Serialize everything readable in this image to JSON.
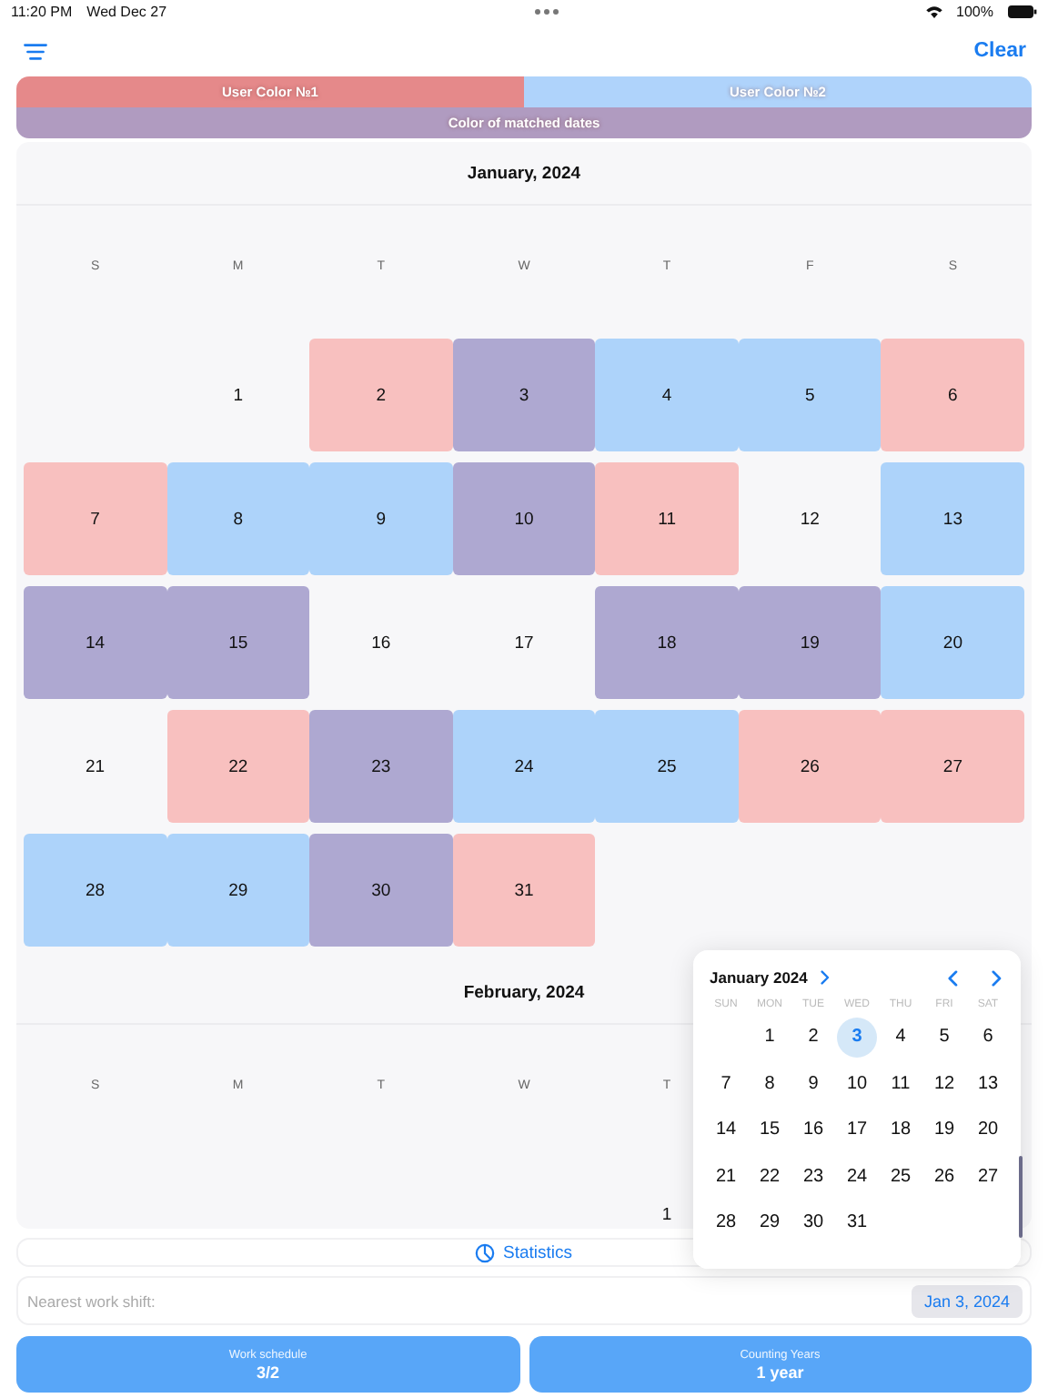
{
  "status_bar": {
    "time": "11:20 PM",
    "date": "Wed Dec 27",
    "battery": "100%"
  },
  "toolbar": {
    "clear": "Clear"
  },
  "legend": {
    "user_1": {
      "label": "User Color №1",
      "color": "#e5898a"
    },
    "user_2": {
      "label": "User Color №2",
      "color": "#afd3fb"
    },
    "matched": {
      "label": "Color of matched dates",
      "color": "#b09bc0"
    }
  },
  "months": [
    {
      "title": "January, 2024",
      "weekdays": [
        "S",
        "M",
        "T",
        "W",
        "T",
        "F",
        "S"
      ],
      "weeks": [
        [
          {
            "kind": "blank"
          },
          {
            "kind": "day",
            "label": "1"
          },
          {
            "kind": "day",
            "label": "2",
            "color": "#f8c0bf"
          },
          {
            "kind": "day",
            "label": "3",
            "color": "#aea8d1"
          },
          {
            "kind": "day",
            "label": "4",
            "color": "#add3fa"
          },
          {
            "kind": "day",
            "label": "5",
            "color": "#add3fa"
          },
          {
            "kind": "day",
            "label": "6",
            "color": "#f8c0bf"
          }
        ],
        [
          {
            "kind": "day",
            "label": "7",
            "color": "#f8c0bf"
          },
          {
            "kind": "day",
            "label": "8",
            "color": "#add3fa"
          },
          {
            "kind": "day",
            "label": "9",
            "color": "#add3fa"
          },
          {
            "kind": "day",
            "label": "10",
            "color": "#aea8d1"
          },
          {
            "kind": "day",
            "label": "11",
            "color": "#f8c0bf"
          },
          {
            "kind": "day",
            "label": "12"
          },
          {
            "kind": "day",
            "label": "13",
            "color": "#add3fa"
          }
        ],
        [
          {
            "kind": "day",
            "label": "14",
            "color": "#aea8d1"
          },
          {
            "kind": "day",
            "label": "15",
            "color": "#aea8d1"
          },
          {
            "kind": "day",
            "label": "16"
          },
          {
            "kind": "day",
            "label": "17"
          },
          {
            "kind": "day",
            "label": "18",
            "color": "#aea8d1"
          },
          {
            "kind": "day",
            "label": "19",
            "color": "#aea8d1"
          },
          {
            "kind": "day",
            "label": "20",
            "color": "#add3fa"
          }
        ],
        [
          {
            "kind": "day",
            "label": "21"
          },
          {
            "kind": "day",
            "label": "22",
            "color": "#f8c0bf"
          },
          {
            "kind": "day",
            "label": "23",
            "color": "#aea8d1"
          },
          {
            "kind": "day",
            "label": "24",
            "color": "#add3fa"
          },
          {
            "kind": "day",
            "label": "25",
            "color": "#add3fa"
          },
          {
            "kind": "day",
            "label": "26",
            "color": "#f8c0bf"
          },
          {
            "kind": "day",
            "label": "27",
            "color": "#f8c0bf"
          }
        ],
        [
          {
            "kind": "day",
            "label": "28",
            "color": "#add3fa"
          },
          {
            "kind": "day",
            "label": "29",
            "color": "#add3fa"
          },
          {
            "kind": "day",
            "label": "30",
            "color": "#aea8d1"
          },
          {
            "kind": "day",
            "label": "31",
            "color": "#f8c0bf"
          }
        ]
      ]
    },
    {
      "title": "February, 2024",
      "weekdays": [
        "S",
        "M",
        "T",
        "W",
        "T"
      ],
      "weeks": [
        [
          {
            "kind": "blank"
          },
          {
            "kind": "blank"
          },
          {
            "kind": "blank"
          },
          {
            "kind": "blank"
          },
          {
            "kind": "day",
            "label": "1"
          }
        ]
      ]
    }
  ],
  "date_picker": {
    "title": "January 2024",
    "weekdays": [
      "SUN",
      "MON",
      "TUE",
      "WED",
      "THU",
      "FRI",
      "SAT"
    ],
    "weeks": [
      [
        {
          "kind": "blank"
        },
        {
          "kind": "day",
          "label": "1",
          "selected": false
        },
        {
          "kind": "day",
          "label": "2",
          "selected": false
        },
        {
          "kind": "day",
          "label": "3",
          "selected": true
        },
        {
          "kind": "day",
          "label": "4",
          "selected": false
        },
        {
          "kind": "day",
          "label": "5",
          "selected": false
        },
        {
          "kind": "day",
          "label": "6",
          "selected": false
        }
      ],
      [
        {
          "kind": "day",
          "label": "7",
          "selected": false
        },
        {
          "kind": "day",
          "label": "8",
          "selected": false
        },
        {
          "kind": "day",
          "label": "9",
          "selected": false
        },
        {
          "kind": "day",
          "label": "10",
          "selected": false
        },
        {
          "kind": "day",
          "label": "11",
          "selected": false
        },
        {
          "kind": "day",
          "label": "12",
          "selected": false
        },
        {
          "kind": "day",
          "label": "13",
          "selected": false
        }
      ],
      [
        {
          "kind": "day",
          "label": "14",
          "selected": false
        },
        {
          "kind": "day",
          "label": "15",
          "selected": false
        },
        {
          "kind": "day",
          "label": "16",
          "selected": false
        },
        {
          "kind": "day",
          "label": "17",
          "selected": false
        },
        {
          "kind": "day",
          "label": "18",
          "selected": false
        },
        {
          "kind": "day",
          "label": "19",
          "selected": false
        },
        {
          "kind": "day",
          "label": "20",
          "selected": false
        }
      ],
      [
        {
          "kind": "day",
          "label": "21",
          "selected": false
        },
        {
          "kind": "day",
          "label": "22",
          "selected": false
        },
        {
          "kind": "day",
          "label": "23",
          "selected": false
        },
        {
          "kind": "day",
          "label": "24",
          "selected": false
        },
        {
          "kind": "day",
          "label": "25",
          "selected": false
        },
        {
          "kind": "day",
          "label": "26",
          "selected": false
        },
        {
          "kind": "day",
          "label": "27",
          "selected": false
        }
      ],
      [
        {
          "kind": "day",
          "label": "28",
          "selected": false
        },
        {
          "kind": "day",
          "label": "29",
          "selected": false
        },
        {
          "kind": "day",
          "label": "30",
          "selected": false
        },
        {
          "kind": "day",
          "label": "31",
          "selected": false
        }
      ]
    ]
  },
  "statistics": {
    "label": "Statistics"
  },
  "nearest_shift": {
    "label": "Nearest work shift:",
    "date": "Jan 3, 2024"
  },
  "bottom_buttons": [
    {
      "caption": "Work schedule",
      "value": "3/2"
    },
    {
      "caption": "Counting Years",
      "value": "1 year"
    }
  ]
}
